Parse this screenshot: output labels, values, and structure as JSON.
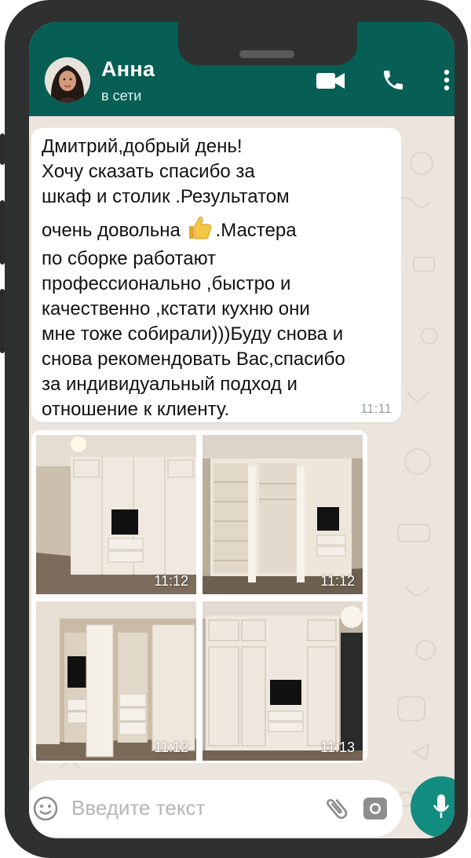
{
  "header": {
    "contact_name": "Анна",
    "status": "в сети",
    "colors": {
      "bar": "#075e54",
      "accent": "#128c7e"
    },
    "icons": [
      "video-call-icon",
      "voice-call-icon",
      "more-menu-icon"
    ]
  },
  "message": {
    "lines": [
      "Дмитрий,добрый день!",
      "Хочу сказать спасибо за",
      "шкаф и столик .Результатом",
      "очень довольна",
      ".Мастера",
      "по сборке работают",
      "профессионально ,быстро и",
      "качественно ,кстати кухню они",
      "мне тоже собирали)))Буду снова и",
      "снова рекомендовать Вас,спасибо",
      "за индивидуальный подход и",
      "отношение к клиенту."
    ],
    "time": "11:11"
  },
  "photos": [
    {
      "time": "11:12"
    },
    {
      "time": "11:12"
    },
    {
      "time": "11:12"
    },
    {
      "time": "11:13"
    }
  ],
  "input": {
    "placeholder": "Введите текст",
    "icons": [
      "emoji-icon",
      "attach-icon",
      "camera-icon",
      "mic-icon"
    ]
  }
}
